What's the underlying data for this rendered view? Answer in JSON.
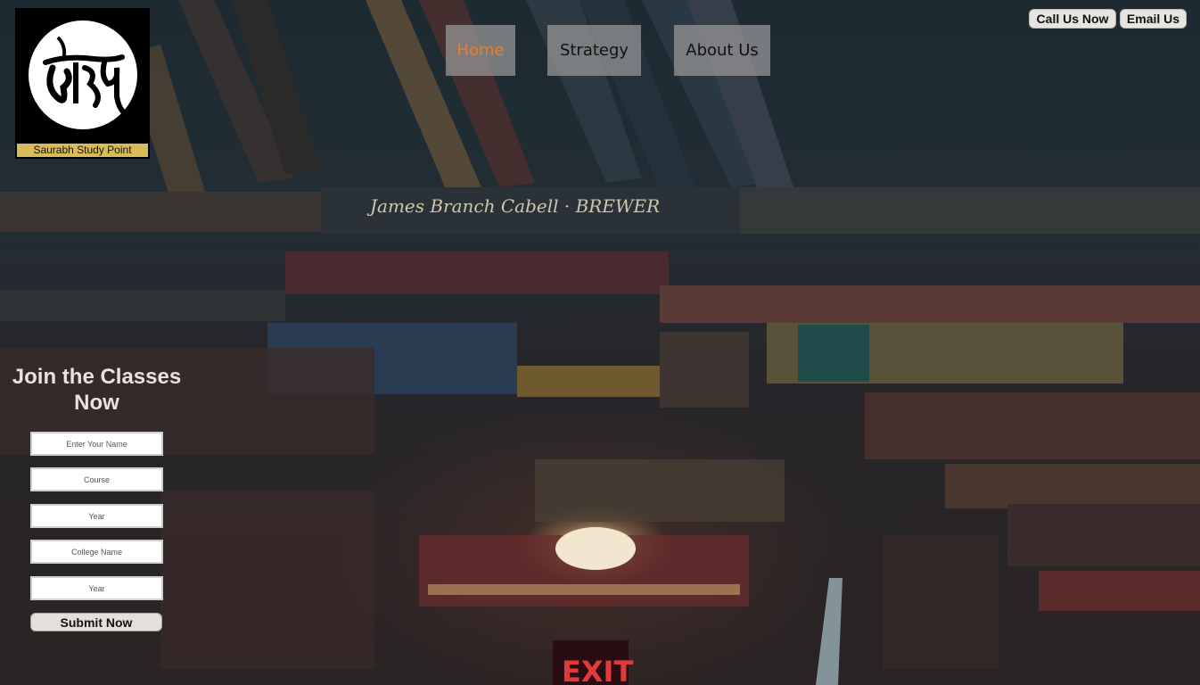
{
  "brand": {
    "logo_icon": "saurabh-devanagari-logo-icon",
    "name": "Saurabh Study Point",
    "caption_color": "#d9bc57"
  },
  "nav": {
    "items": [
      {
        "label": "Home",
        "active": true
      },
      {
        "label": "Strategy",
        "active": false
      },
      {
        "label": "About Us",
        "active": false
      }
    ],
    "active_color": "#f27b2a"
  },
  "contact": {
    "call_label": "Call Us Now",
    "email_label": "Email Us"
  },
  "join_form": {
    "title": "Join the Classes Now",
    "fields": [
      {
        "placeholder": "Enter Your Name",
        "value": ""
      },
      {
        "placeholder": "Course",
        "value": ""
      },
      {
        "placeholder": "Year",
        "value": ""
      },
      {
        "placeholder": "College Name",
        "value": ""
      },
      {
        "placeholder": "Year",
        "value": ""
      }
    ],
    "submit_label": "Submit Now"
  },
  "background": {
    "book_spine_text": "James Branch Cabell · BREWER",
    "exit_sign": "EXIT"
  }
}
